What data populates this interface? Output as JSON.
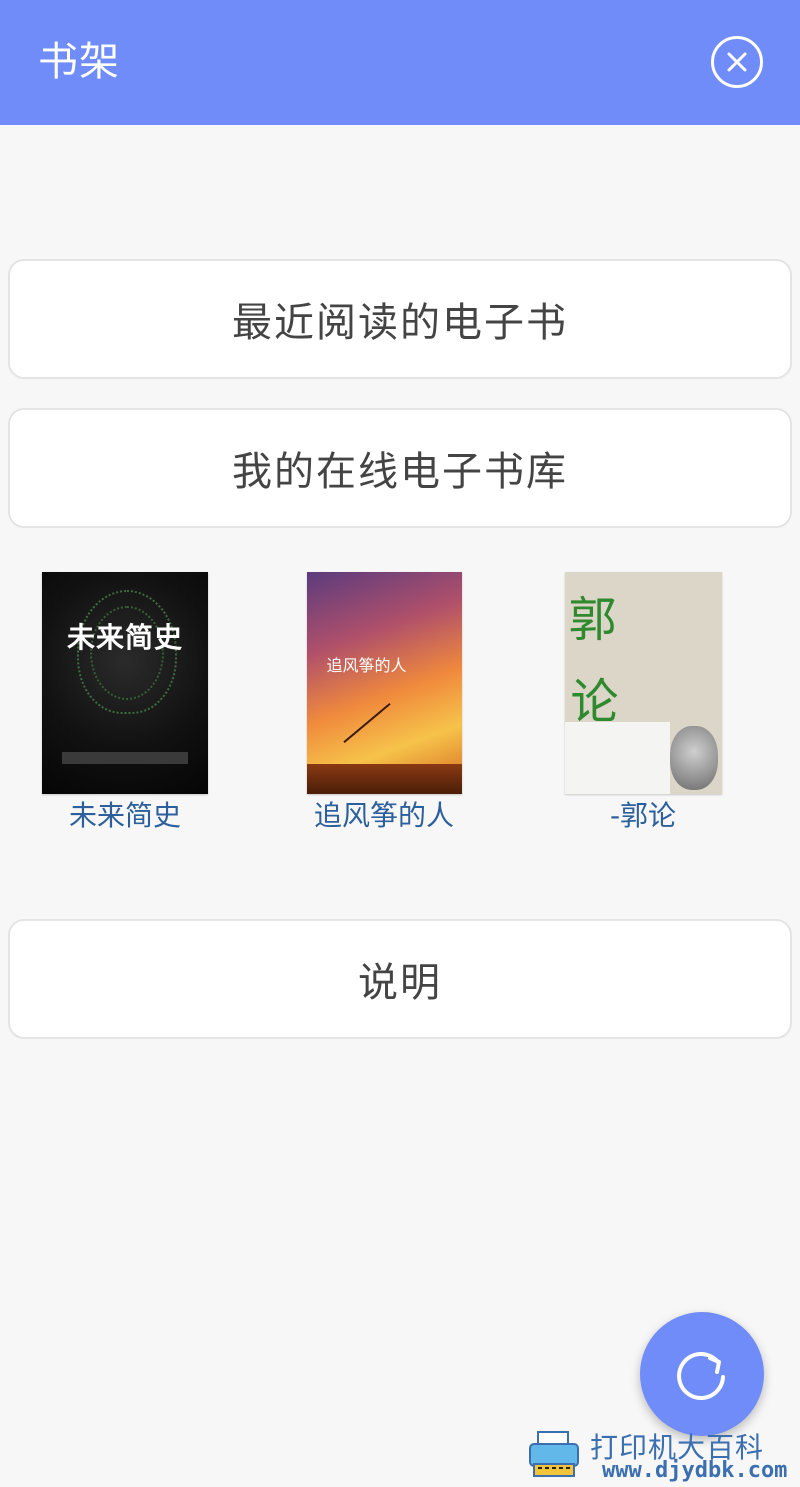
{
  "header": {
    "title": "书架",
    "close_icon": "close-circle-icon",
    "background": "#708cf8"
  },
  "menu": {
    "recent_label": "最近阅读的电子书",
    "library_label": "我的在线电子书库",
    "info_label": "说明"
  },
  "books": [
    {
      "title": "未来简史",
      "cover_title": "未来简史"
    },
    {
      "title": "追风筝的人",
      "cover_title": "追风筝的人"
    },
    {
      "title": "-郭论",
      "cover_title": "郭论"
    }
  ],
  "fab": {
    "icon": "refresh-icon"
  },
  "watermark": {
    "line1": "打印机大百科",
    "line2": "www.djydbk.com"
  }
}
